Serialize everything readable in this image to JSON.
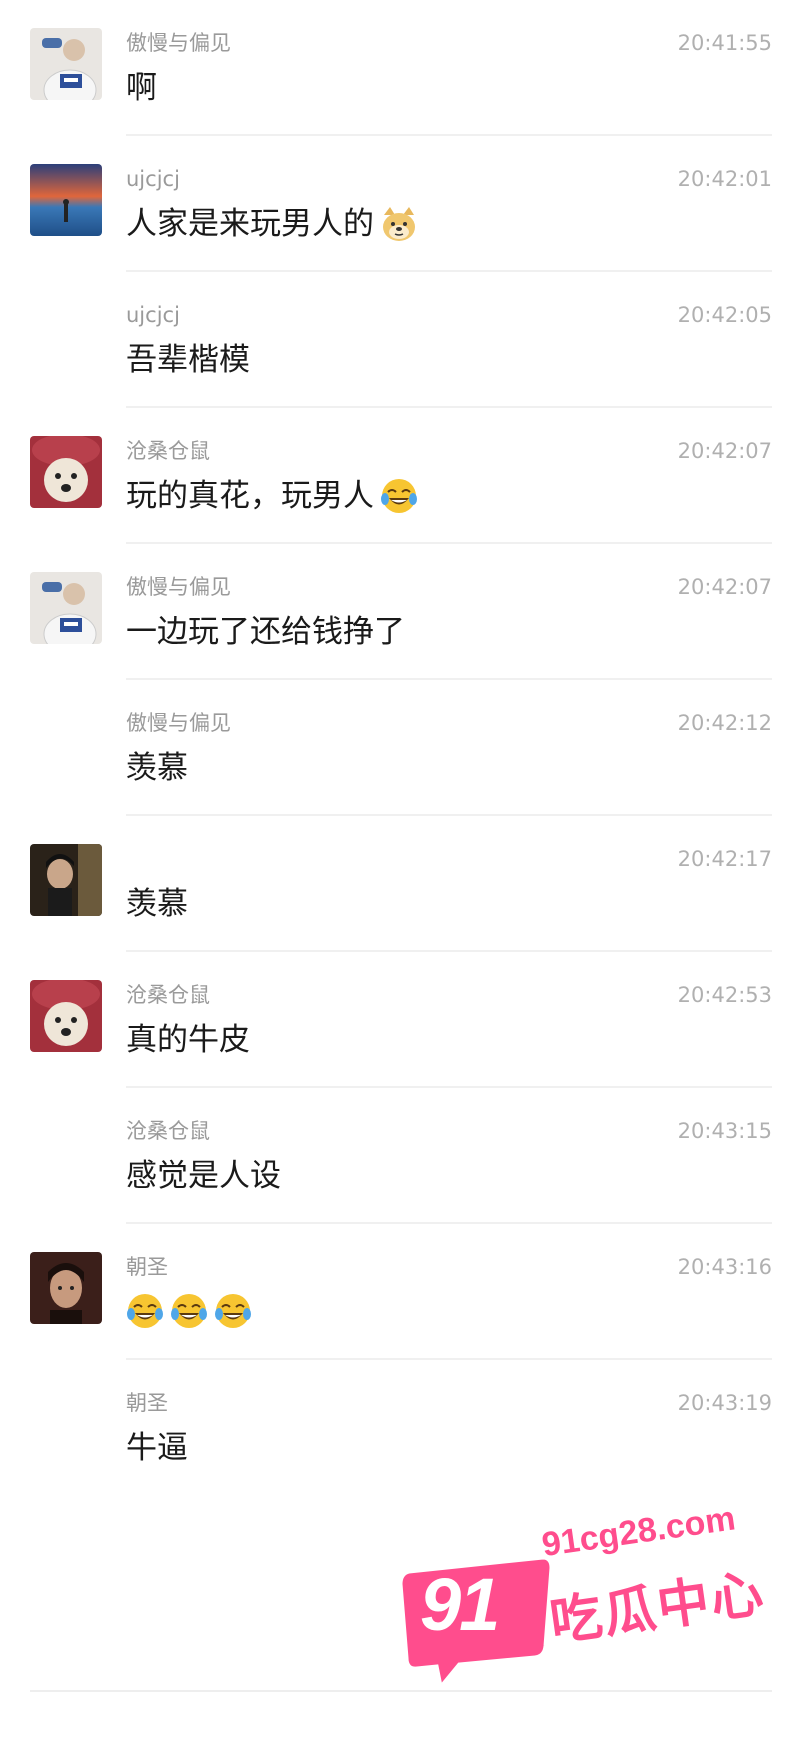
{
  "messages": [
    {
      "sender": "傲慢与偏见",
      "time": "20:41:55",
      "text": "啊",
      "avatar": "white-shirt-man-avatar",
      "emojis": []
    },
    {
      "sender": "ujcjcj",
      "time": "20:42:01",
      "text": "人家是来玩男人的",
      "avatar": "sunset-lake-avatar",
      "emojis": [
        "doge-emoji"
      ]
    },
    {
      "sender": "ujcjcj",
      "time": "20:42:05",
      "text": "吾辈楷模",
      "avatar": "",
      "emojis": []
    },
    {
      "sender": "沧桑仓鼠",
      "time": "20:42:07",
      "text": "玩的真花，玩男人",
      "avatar": "dog-in-red-hat-avatar",
      "emojis": [
        "laugh-cry-emoji"
      ]
    },
    {
      "sender": "傲慢与偏见",
      "time": "20:42:07",
      "text": "一边玩了还给钱挣了",
      "avatar": "white-shirt-man-avatar",
      "emojis": []
    },
    {
      "sender": "傲慢与偏见",
      "time": "20:42:12",
      "text": "羡慕",
      "avatar": "",
      "emojis": []
    },
    {
      "sender": "",
      "time": "20:42:17",
      "text": "羡慕",
      "avatar": "dark-photo-man-avatar",
      "emojis": []
    },
    {
      "sender": "沧桑仓鼠",
      "time": "20:42:53",
      "text": "真的牛皮",
      "avatar": "dog-in-red-hat-avatar",
      "emojis": []
    },
    {
      "sender": "沧桑仓鼠",
      "time": "20:43:15",
      "text": "感觉是人设",
      "avatar": "",
      "emojis": []
    },
    {
      "sender": "朝圣",
      "time": "20:43:16",
      "text": "",
      "avatar": "man-portrait-avatar",
      "emojis": [
        "laugh-cry-emoji",
        "laugh-cry-emoji",
        "laugh-cry-emoji"
      ]
    },
    {
      "sender": "朝圣",
      "time": "20:43:19",
      "text": "牛逼",
      "avatar": "",
      "emojis": []
    }
  ],
  "watermark": {
    "url": "91cg28.com",
    "badge": "91",
    "title": "吃瓜中心",
    "color": "#ff4d8d"
  }
}
